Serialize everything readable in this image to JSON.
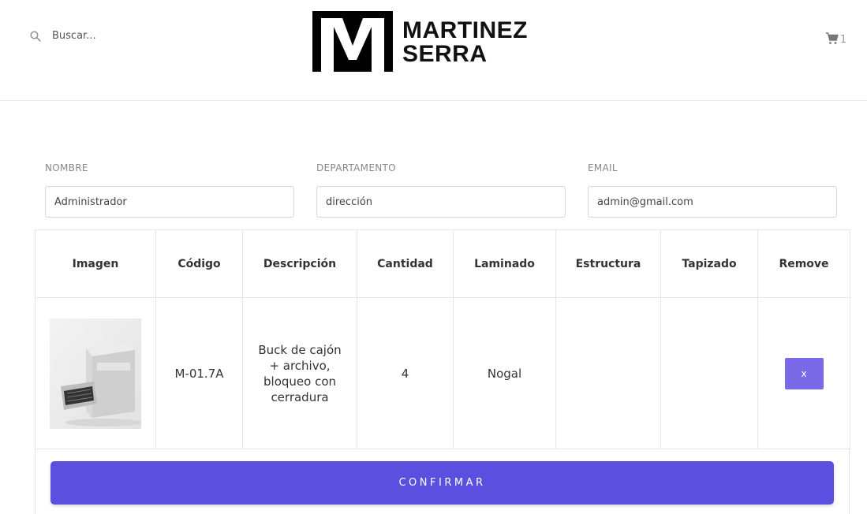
{
  "header": {
    "search_placeholder": "Buscar...",
    "logo_line1": "MARTINEZ",
    "logo_line2": "SERRA",
    "cart_count": "1",
    "icons": {
      "search": "search-icon",
      "cart": "cart-icon"
    }
  },
  "form": {
    "nombre_label": "NOMBRE",
    "nombre_value": "Administrador",
    "departamento_label": "DEPARTAMENTO",
    "departamento_value": "dirección",
    "email_label": "EMAIL",
    "email_value": "admin@gmail.com"
  },
  "table": {
    "headers": [
      "Imagen",
      "Código",
      "Descripción",
      "Cantidad",
      "Laminado",
      "Estructura",
      "Tapizado",
      "Remove"
    ],
    "rows": [
      {
        "codigo": "M-01.7A",
        "descripcion": "Buck de cajón + archivo, bloqueo con cerradura",
        "cantidad": "4",
        "laminado": "Nogal",
        "estructura": "",
        "tapizado": "",
        "remove_label": "x"
      }
    ]
  },
  "confirm_label": "CONFIRMAR",
  "colors": {
    "confirm": "#5b4fe0",
    "remove": "#7a6ae8"
  }
}
